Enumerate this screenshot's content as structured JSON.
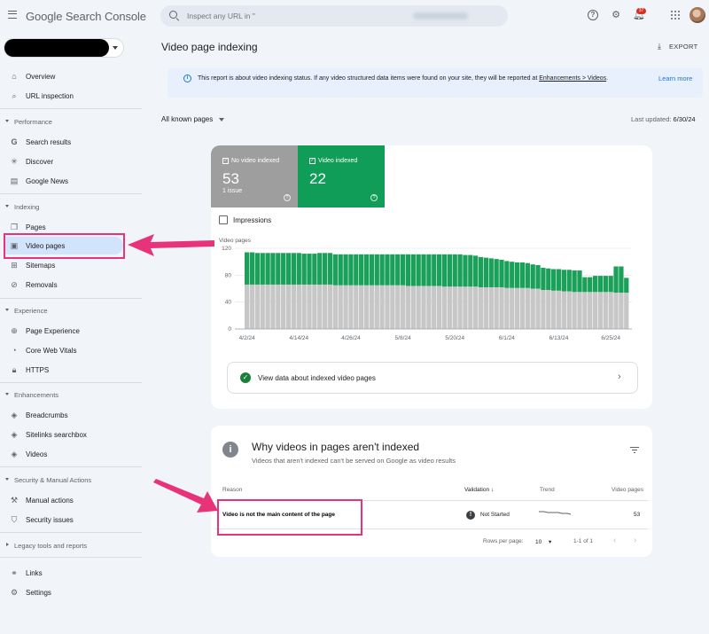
{
  "header": {
    "logo_google": "Google",
    "logo_product": "Search Console",
    "search_placeholder": "Inspect any URL in \"",
    "notification_count": "37"
  },
  "sidebar": {
    "overview": "Overview",
    "url_inspection": "URL inspection",
    "performance_section": "Performance",
    "search_results": "Search results",
    "discover": "Discover",
    "google_news": "Google News",
    "indexing_section": "Indexing",
    "pages": "Pages",
    "video_pages": "Video pages",
    "sitemaps": "Sitemaps",
    "removals": "Removals",
    "experience_section": "Experience",
    "page_experience": "Page Experience",
    "core_web_vitals": "Core Web Vitals",
    "https": "HTTPS",
    "enhancements_section": "Enhancements",
    "breadcrumbs": "Breadcrumbs",
    "sitelinks_searchbox": "Sitelinks searchbox",
    "videos": "Videos",
    "security_section": "Security & Manual Actions",
    "manual_actions": "Manual actions",
    "security_issues": "Security issues",
    "legacy_section": "Legacy tools and reports",
    "links": "Links",
    "settings": "Settings"
  },
  "main": {
    "title": "Video page indexing",
    "export_label": "EXPORT",
    "info_text_before": "This report is about video indexing status. If any video structured data items were found on your site, they will be reported at ",
    "info_link": "Enhancements > Videos",
    "info_text_after": ".",
    "learn_more": "Learn more",
    "filter_label": "All known pages",
    "last_updated_label": "Last updated: ",
    "last_updated_value": "6/30/24"
  },
  "summary": {
    "not_indexed_label": "No video indexed",
    "not_indexed_value": "53",
    "not_indexed_sub": "1 issue",
    "indexed_label": "Video indexed",
    "indexed_value": "22",
    "impressions_label": "Impressions",
    "view_data_label": "View data about indexed video pages"
  },
  "colors": {
    "not_indexed": "#9e9e9e",
    "indexed": "#0f9d58",
    "bar_grey": "#c7c7c7",
    "bar_green": "#1ba05a",
    "highlight": "#e8337a",
    "accent_blue": "#1a73e8"
  },
  "chart_data": {
    "type": "bar",
    "ylabel": "Video pages",
    "ylim": [
      0,
      120
    ],
    "yticks": [
      0,
      40,
      80,
      120
    ],
    "xtick_labels": [
      "4/2/24",
      "4/14/24",
      "4/26/24",
      "5/8/24",
      "5/20/24",
      "6/1/24",
      "6/13/24",
      "6/25/24"
    ],
    "series": [
      {
        "name": "No video indexed",
        "values": [
          66,
          66,
          66,
          66,
          66,
          66,
          66,
          66,
          66,
          66,
          66,
          66,
          66,
          66,
          66,
          66,
          66,
          65,
          65,
          65,
          65,
          65,
          65,
          65,
          65,
          65,
          65,
          65,
          65,
          65,
          65,
          64,
          64,
          64,
          64,
          64,
          64,
          64,
          63,
          63,
          63,
          63,
          63,
          63,
          63,
          62,
          62,
          62,
          62,
          62,
          61,
          61,
          61,
          61,
          61,
          60,
          60,
          58,
          58,
          57,
          57,
          56,
          56,
          55,
          55,
          55,
          55,
          55,
          55,
          55,
          55,
          54,
          54,
          54
        ]
      },
      {
        "name": "Video indexed",
        "values": [
          48,
          48,
          47,
          47,
          47,
          47,
          47,
          47,
          47,
          47,
          47,
          46,
          46,
          46,
          47,
          47,
          47,
          46,
          46,
          46,
          46,
          46,
          46,
          46,
          46,
          46,
          46,
          46,
          46,
          46,
          46,
          47,
          47,
          47,
          47,
          47,
          47,
          47,
          48,
          48,
          48,
          48,
          47,
          47,
          46,
          45,
          44,
          43,
          42,
          41,
          40,
          39,
          38,
          38,
          37,
          36,
          35,
          33,
          32,
          32,
          32,
          32,
          32,
          32,
          32,
          22,
          22,
          24,
          24,
          24,
          24,
          39,
          39,
          22
        ]
      }
    ]
  },
  "issues_table": {
    "title": "Why videos in pages aren't indexed",
    "subtitle": "Videos that aren't indexed can't be served on Google as video results",
    "col_reason": "Reason",
    "col_validation": "Validation",
    "col_trend": "Trend",
    "col_pages": "Video pages",
    "rows": [
      {
        "reason": "Video is not the main content of the page",
        "validation": "Not Started",
        "pages": "53"
      }
    ],
    "rows_per_page_label": "Rows per page:",
    "rows_per_page_value": "10",
    "range": "1-1 of 1"
  }
}
